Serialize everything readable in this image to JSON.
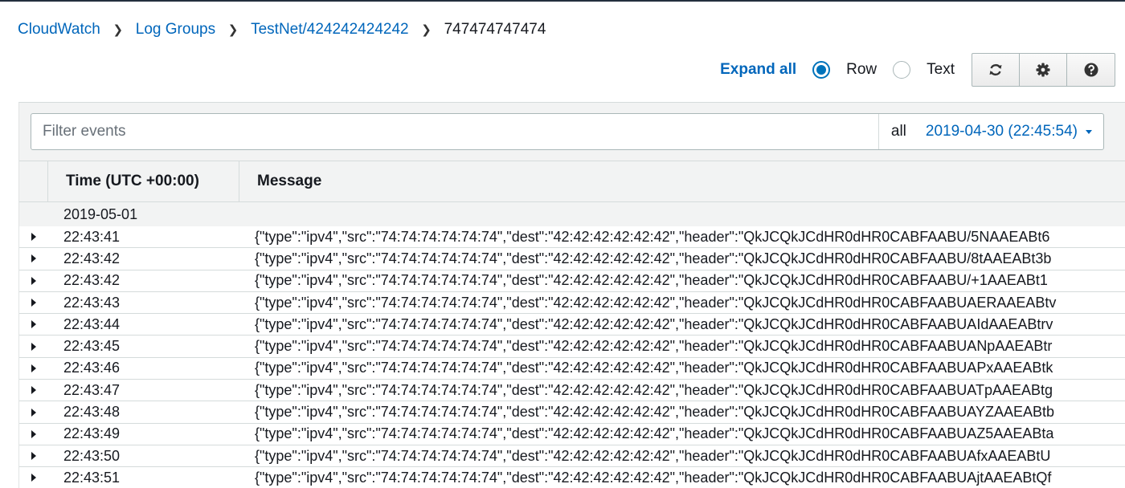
{
  "breadcrumb": {
    "items": [
      "CloudWatch",
      "Log Groups",
      "TestNet/424242424242"
    ],
    "current": "747474747474"
  },
  "toolbar": {
    "expand_all": "Expand all",
    "view_mode": {
      "options": [
        "Row",
        "Text"
      ],
      "selected": "Row"
    },
    "icons": [
      "refresh-icon",
      "gear-icon",
      "help-icon"
    ]
  },
  "filter": {
    "placeholder": "Filter events",
    "value": "",
    "range_label": "all",
    "range_date": "2019-04-30 (22:45:54)"
  },
  "table": {
    "headers": {
      "time": "Time (UTC +00:00)",
      "message": "Message"
    },
    "date_group": "2019-05-01",
    "rows": [
      {
        "time": "22:43:41",
        "message": "{\"type\":\"ipv4\",\"src\":\"74:74:74:74:74:74\",\"dest\":\"42:42:42:42:42:42\",\"header\":\"QkJCQkJCdHR0dHR0CABFAABU/5NAAEABt6"
      },
      {
        "time": "22:43:42",
        "message": "{\"type\":\"ipv4\",\"src\":\"74:74:74:74:74:74\",\"dest\":\"42:42:42:42:42:42\",\"header\":\"QkJCQkJCdHR0dHR0CABFAABU/8tAAEABt3b"
      },
      {
        "time": "22:43:42",
        "message": "{\"type\":\"ipv4\",\"src\":\"74:74:74:74:74:74\",\"dest\":\"42:42:42:42:42:42\",\"header\":\"QkJCQkJCdHR0dHR0CABFAABU/+1AAEABt1"
      },
      {
        "time": "22:43:43",
        "message": "{\"type\":\"ipv4\",\"src\":\"74:74:74:74:74:74\",\"dest\":\"42:42:42:42:42:42\",\"header\":\"QkJCQkJCdHR0dHR0CABFAABUAERAAEABtv"
      },
      {
        "time": "22:43:44",
        "message": "{\"type\":\"ipv4\",\"src\":\"74:74:74:74:74:74\",\"dest\":\"42:42:42:42:42:42\",\"header\":\"QkJCQkJCdHR0dHR0CABFAABUAIdAAEABtrv"
      },
      {
        "time": "22:43:45",
        "message": "{\"type\":\"ipv4\",\"src\":\"74:74:74:74:74:74\",\"dest\":\"42:42:42:42:42:42\",\"header\":\"QkJCQkJCdHR0dHR0CABFAABUANpAAEABtr"
      },
      {
        "time": "22:43:46",
        "message": "{\"type\":\"ipv4\",\"src\":\"74:74:74:74:74:74\",\"dest\":\"42:42:42:42:42:42\",\"header\":\"QkJCQkJCdHR0dHR0CABFAABUAPxAAEABtk"
      },
      {
        "time": "22:43:47",
        "message": "{\"type\":\"ipv4\",\"src\":\"74:74:74:74:74:74\",\"dest\":\"42:42:42:42:42:42\",\"header\":\"QkJCQkJCdHR0dHR0CABFAABUATpAAEABtg"
      },
      {
        "time": "22:43:48",
        "message": "{\"type\":\"ipv4\",\"src\":\"74:74:74:74:74:74\",\"dest\":\"42:42:42:42:42:42\",\"header\":\"QkJCQkJCdHR0dHR0CABFAABUAYZAAEABtb"
      },
      {
        "time": "22:43:49",
        "message": "{\"type\":\"ipv4\",\"src\":\"74:74:74:74:74:74\",\"dest\":\"42:42:42:42:42:42\",\"header\":\"QkJCQkJCdHR0dHR0CABFAABUAZ5AAEABta"
      },
      {
        "time": "22:43:50",
        "message": "{\"type\":\"ipv4\",\"src\":\"74:74:74:74:74:74\",\"dest\":\"42:42:42:42:42:42\",\"header\":\"QkJCQkJCdHR0dHR0CABFAABUAfxAAEABtU"
      },
      {
        "time": "22:43:51",
        "message": "{\"type\":\"ipv4\",\"src\":\"74:74:74:74:74:74\",\"dest\":\"42:42:42:42:42:42\",\"header\":\"QkJCQkJCdHR0dHR0CABFAABUAjtAAEABtQf"
      }
    ]
  },
  "colors": {
    "link": "#0066bb",
    "radio_selected": "#0073bb",
    "panel_bg": "#f2f3f3",
    "border": "#d5dbdb"
  }
}
